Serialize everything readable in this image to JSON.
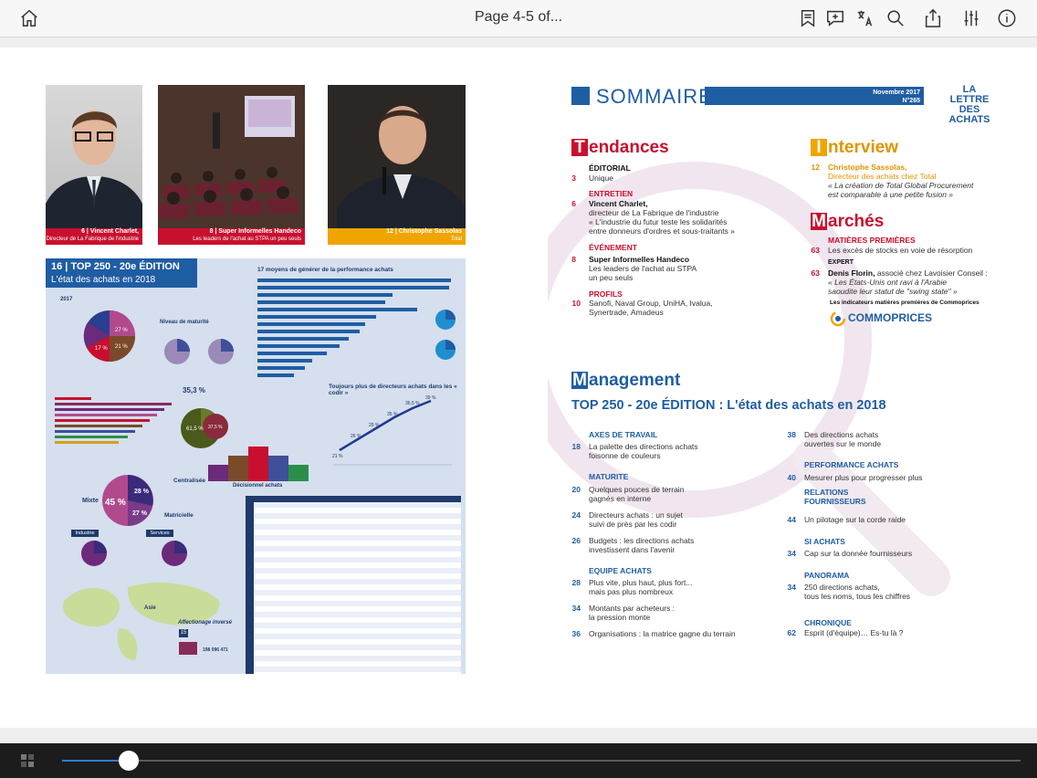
{
  "toolbar": {
    "page_label": "Page 4-5 of...",
    "icons": [
      "home-icon",
      "bookmarks-icon",
      "add-note-icon",
      "translate-icon",
      "search-icon",
      "share-icon",
      "settings-sliders-icon",
      "info-icon"
    ]
  },
  "left_page": {
    "photos": [
      {
        "num": "6",
        "name": "Vincent Charlet,",
        "sub": "Directeur de La Fabrique de l'industrie"
      },
      {
        "num": "8",
        "name": "Super Informelles Handeco",
        "sub": "Les leaders de l'achat au STPA un peu seuls"
      },
      {
        "num": "12",
        "name": "Christophe Sassolas",
        "sub": "Total"
      }
    ],
    "infographic": {
      "number": "16",
      "title": "TOP 250 - 20e ÉDITION",
      "subtitle": "L'état des achats en 2018",
      "bars_title": "17 moyens de générer de la performance achats",
      "line_title": "Toujours plus de directeurs achats dans les « codir »",
      "year": "2017",
      "maturity": "Niveau de maturité",
      "industrie": "Industrie",
      "services": "Services",
      "mixte": "Mixte",
      "centralisee": "Centralisée",
      "matricielle": "Matricielle",
      "pct45": "45 %",
      "pct28": "28 %",
      "pct27": "27 %",
      "decisionnel": "Décisionnel achats",
      "line_values": [
        "21 %",
        "26 %",
        "29 %",
        "35 %",
        "36,5 %",
        "39 %"
      ],
      "asie": "Asie",
      "affectation": "Affectionage inversé",
      "pct_325": "35,3 %",
      "pct_615": "61,5 %",
      "pct_375": "37,5 %",
      "badge15": "15",
      "value_big": "198 096 471"
    }
  },
  "right_page": {
    "header": {
      "title": "SOMMAIRE",
      "date": "Novembre 2017",
      "issue": "N°265",
      "brand_line1": "LA LETTRE",
      "brand_line2": "DES ACHATS"
    },
    "tendances": {
      "heading_initial": "T",
      "heading_rest": "endances",
      "editorial_label": "ÉDITORIAL",
      "editorial_page": "3",
      "editorial_text": "Unique",
      "entretien_label": "ENTRETIEN",
      "entretien_page": "6",
      "entretien_name": "Vincent Charlet,",
      "entretien_role": "directeur de La Fabrique de l'industrie",
      "entretien_quote1": "« L'industrie du futur teste les solidarités",
      "entretien_quote2": "entre donneurs d'ordres et sous-traitants »",
      "evenement_label": "ÉVÉNEMENT",
      "evenement_page": "8",
      "evenement_name": "Super Informelles Handeco",
      "evenement_text1": "Les leaders de l'achat au STPA",
      "evenement_text2": "un peu seuls",
      "profils_label": "PROFILS",
      "profils_page": "10",
      "profils_text1": "Sanofi, Naval Group, UniHA, Ivalua,",
      "profils_text2": "Synertrade, Amadeus"
    },
    "interview": {
      "heading_initial": "I",
      "heading_rest": "nterview",
      "page": "12",
      "name": "Christophe Sassolas,",
      "role": "Directeur des achats chez Total",
      "quote1": "« La création de Total Global Procurement",
      "quote2": "est comparable à une petite fusion »"
    },
    "marches": {
      "heading_initial": "M",
      "heading_rest": "archés",
      "mp_label": "MATIÈRES PREMIÈRES",
      "mp_page": "63",
      "mp_text": "Les excès de stocks en voie de résorption",
      "expert_label": "EXPERT",
      "expert_page": "63",
      "expert_name": "Denis Florin,",
      "expert_role": " associé chez Lavoisier Conseil :",
      "expert_quote1": "« Les États-Unis ont ravi à l'Arabie",
      "expert_quote2": "saoudite leur statut de \"swing state\" »",
      "indicators": "Les indicateurs matières premières de Commoprices",
      "logo": "COMMOPRICES"
    },
    "management": {
      "heading_initial": "M",
      "heading_rest": "anagement",
      "top_title": "TOP 250 - 20e ÉDITION : L'état des achats en 2018",
      "left": [
        {
          "cat": "AXES DE TRAVAIL",
          "items": [
            {
              "page": "18",
              "l1": "La palette des directions achats",
              "l2": "foisonne de couleurs"
            }
          ]
        },
        {
          "cat": "MATURITE",
          "items": [
            {
              "page": "20",
              "l1": "Quelques pouces de terrain",
              "l2": "gagnés en interne"
            },
            {
              "page": "24",
              "l1": "Directeurs achats : un sujet",
              "l2": "suivi de près par les codir"
            },
            {
              "page": "26",
              "l1": "Budgets : les directions achats",
              "l2": "investissent dans l'avenir"
            }
          ]
        },
        {
          "cat": "EQUIPE ACHATS",
          "items": [
            {
              "page": "28",
              "l1": "Plus vite, plus haut, plus fort...",
              "l2": "mais pas plus nombreux"
            },
            {
              "page": "34",
              "l1": "Montants par acheteurs :",
              "l2": "la pression monte"
            },
            {
              "page": "36",
              "l1": "Organisations : la matrice gagne du terrain",
              "l2": ""
            }
          ]
        }
      ],
      "right": [
        {
          "cat": "",
          "items": [
            {
              "page": "38",
              "l1": "Des directions achats",
              "l2": "ouvertes sur le monde"
            }
          ]
        },
        {
          "cat": "PERFORMANCE ACHATS",
          "items": [
            {
              "page": "40",
              "l1": "Mesurer plus pour progresser plus",
              "l2": ""
            }
          ]
        },
        {
          "cat": "RELATIONS FOURNISSEURS",
          "items": [
            {
              "page": "44",
              "l1": "Un pilotage sur la corde raide",
              "l2": ""
            }
          ]
        },
        {
          "cat": "SI ACHATS",
          "items": [
            {
              "page": "34",
              "l1": "Cap sur la donnée fournisseurs",
              "l2": ""
            }
          ]
        },
        {
          "cat": "PANORAMA",
          "items": [
            {
              "page": "34",
              "l1": "250 directions achats,",
              "l2": "tous les noms, tous les chiffres"
            }
          ]
        },
        {
          "cat": "CHRONIQUE",
          "items": [
            {
              "page": "62",
              "l1": "Esprit (d'équipe)… Es-tu là ?",
              "l2": ""
            }
          ]
        }
      ]
    }
  },
  "bottom": {
    "thumbnails_icon": "grid-thumbnails-icon",
    "progress": 0.07
  }
}
